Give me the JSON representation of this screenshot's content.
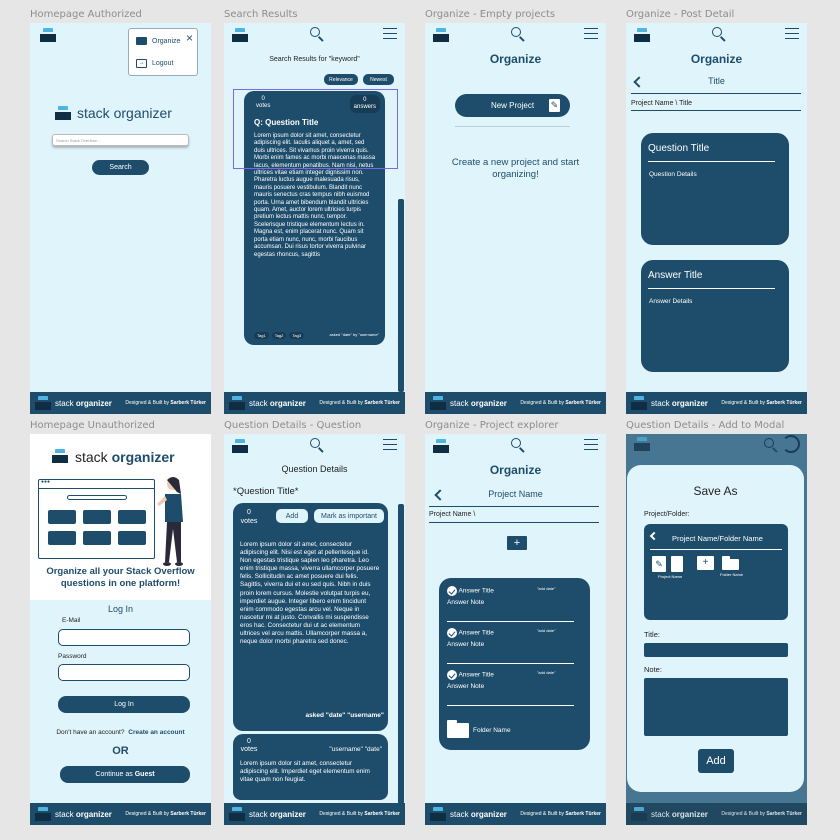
{
  "brand": {
    "stack": "stack",
    "organizer": "organizer"
  },
  "footer": {
    "designed": "Designed & Built by",
    "author": "Sarberk Türker"
  },
  "frame_labels": {
    "homepage_authorized": "Homepage Authorized",
    "search_results": "Search Results",
    "organize_empty": "Organize - Empty projects",
    "organize_post_detail": "Organize - Post Detail",
    "homepage_unauthorized": "Homepage Unauthorized",
    "question_details": "Question Details - Question",
    "project_explorer": "Organize - Project explorer",
    "add_to_modal": "Question Details - Add to Modal"
  },
  "homepage_auth": {
    "menu": {
      "organize": "Organize",
      "logout": "Logout"
    },
    "search_placeholder": "Search Stack Overflow...",
    "search_button": "Search"
  },
  "search_results": {
    "heading": "Search Results for \"keyword\"",
    "sort": {
      "relevance": "Relevance",
      "newest": "Newest"
    },
    "votes_count": "0",
    "votes_label": "votes",
    "answers_count": "0",
    "answers_label": "answers",
    "question_title": "Q: Question Title",
    "body": "Lorem ipsum dolor sit amet, consectetur adipiscing elit. Iaculis aliquet a, amet, sed duis ultrices. Sit vivamus proin viverra quis. Morbi enim fames ac morbi maecenas massa lacus, elementum penatibus. Nam nisi, netus ultrices vitae etiam integer dignissim non. Pharetra luctus augue malesuada risus, mauris posuere vestibulum. Blandit nunc mauris senectus cras tempus nibh euismod porta. Urna amet bibendum blandit ultricies quam. Amet, auctor lorem ultricies turpis pretium lectus mattis nunc, tempor. Scelerisque tristique elementum lectus in. Magna est, enim placerat nunc. Quam sit porta etiam nunc, nunc, morbi faucibus accumsan. Dui risus tortor viverra pulvinar egestas rhoncus, sagittis",
    "tags": [
      "Tag1",
      "Tag2",
      "Tag3"
    ],
    "asked": "asked \"date\" by \"username\""
  },
  "organize_empty": {
    "title": "Organize",
    "new_project": "New Project",
    "empty_text": "Create a new project and start organizing!"
  },
  "post_detail": {
    "title": "Organize",
    "subtitle": "Title",
    "path": "Project Name \\ Title",
    "question_title": "Question Title",
    "question_details": "Question Details",
    "answer_title": "Answer Title",
    "answer_details": "Answer Details"
  },
  "homepage_unauth": {
    "tagline": "Organize all your Stack Overflow questions in one platform!",
    "login_title": "Log In",
    "email_label": "E-Mail",
    "password_label": "Password",
    "login_button": "Log In",
    "no_account": "Don't have an account?",
    "create_account": "Create an account",
    "or": "OR",
    "continue_prefix": "Continue as",
    "guest": "Guest"
  },
  "question_details": {
    "heading": "Question Details",
    "question_title": "*Question Title*",
    "votes_count": "0",
    "votes_label": "votes",
    "add": "Add",
    "mark": "Mark as important",
    "body": "Lorem ipsum dolor sit amet, consectetur adipiscing elit. Nisi est eget at pellentesque id. Non egestas tristique sapien leo pharetra. Leo enim tristique massa, viverra ullamcorper posuere felis. Sollicitudin ac amet posuere dui felis. Sagittis, viverra dui et eu sed quis. Nibh in duis proin lorem cursus. Molestie volutpat turpis eu, imperdiet augue. Integer libero enim tincidunt enim commodo egestas arcu vel. Neque in nascetur mi at justo. Convallis mi suspendisse eros hac. Consectetur dui ut ac elementum ultrices vel arcu mattis. Ullamcorper massa a, neque dolor morbi pharetra sed donec.",
    "asked": "asked \"date\" \"username\"",
    "answer_votes_count": "0",
    "answer_votes_label": "votes",
    "answer_meta": "\"username\" \"date\"",
    "answer_body": "Lorem ipsum dolor sit amet, consectetur adipiscing elit. Imperdiet eget elementum enim vitae quam non feugiat."
  },
  "project_explorer": {
    "title": "Organize",
    "project_name": "Project Name",
    "path": "Project Name \\",
    "items": [
      {
        "title": "Answer Title",
        "date": "\"add date\"",
        "note": "Answer Note"
      },
      {
        "title": "Answer Title",
        "date": "\"add date\"",
        "note": "Answer Note"
      },
      {
        "title": "Answer Title",
        "date": "\"add date\"",
        "note": "Answer Note"
      }
    ],
    "folder_name": "Folder Name"
  },
  "modal": {
    "title": "Save As",
    "project_folder_label": "Project/Folder:",
    "breadcrumb": "Project Name/Folder Name",
    "project_name": "Project Name",
    "folder_name": "Folder Name",
    "title_label": "Title:",
    "note_label": "Note:",
    "add": "Add"
  }
}
